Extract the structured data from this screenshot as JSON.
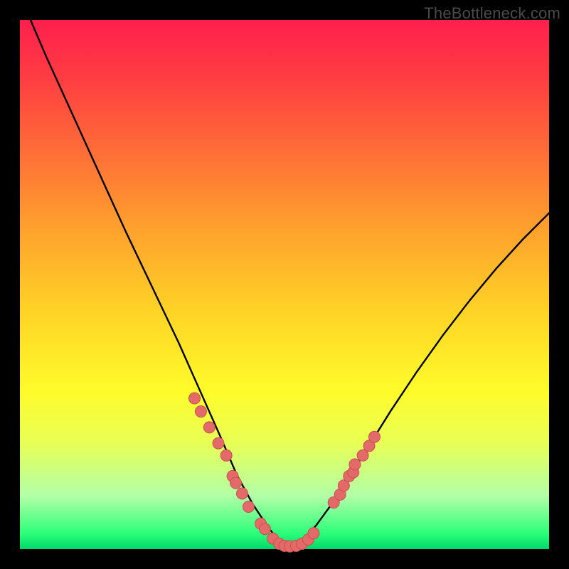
{
  "watermark": "TheBottleneck.com",
  "chart_data": {
    "type": "line",
    "title": "",
    "xlabel": "",
    "ylabel": "",
    "xlim": [
      0,
      100
    ],
    "ylim": [
      0,
      100
    ],
    "legend": false,
    "grid": false,
    "gradient_background": {
      "top_color": "#ff1f4d",
      "bottom_color": "#00d96a",
      "description": "vertical red→orange→yellow→green gradient"
    },
    "series": [
      {
        "name": "bottleneck-curve",
        "stroke": "#000000",
        "x": [
          2,
          5,
          10,
          15,
          20,
          25,
          30,
          34,
          38,
          41,
          44,
          47,
          49,
          51,
          53,
          56,
          60,
          65,
          70,
          75,
          80,
          85,
          90,
          95,
          100
        ],
        "y": [
          100,
          93,
          82,
          71,
          60,
          49.5,
          39,
          30,
          21,
          14,
          8.5,
          4,
          1.5,
          0.5,
          1.2,
          4.5,
          10,
          18,
          26,
          33.5,
          40.5,
          47,
          53,
          58.5,
          63.5
        ]
      }
    ],
    "markers": {
      "name": "highlight-dots",
      "fill": "#e46a6a",
      "stroke": "#c94f4f",
      "radius": 8,
      "points": [
        {
          "x": 33.0,
          "y": 28.5
        },
        {
          "x": 34.2,
          "y": 26.0
        },
        {
          "x": 35.8,
          "y": 23.0
        },
        {
          "x": 37.5,
          "y": 20.0
        },
        {
          "x": 39.0,
          "y": 17.7
        },
        {
          "x": 40.2,
          "y": 13.8
        },
        {
          "x": 40.8,
          "y": 12.5
        },
        {
          "x": 42.0,
          "y": 10.5
        },
        {
          "x": 43.2,
          "y": 8.0
        },
        {
          "x": 45.5,
          "y": 4.8
        },
        {
          "x": 46.3,
          "y": 3.8
        },
        {
          "x": 47.8,
          "y": 2.0
        },
        {
          "x": 49.0,
          "y": 1.0
        },
        {
          "x": 50.0,
          "y": 0.6
        },
        {
          "x": 51.0,
          "y": 0.5
        },
        {
          "x": 52.2,
          "y": 0.6
        },
        {
          "x": 53.3,
          "y": 1.0
        },
        {
          "x": 54.5,
          "y": 1.8
        },
        {
          "x": 55.5,
          "y": 3.0
        },
        {
          "x": 59.3,
          "y": 8.8
        },
        {
          "x": 60.5,
          "y": 10.3
        },
        {
          "x": 61.2,
          "y": 12.0
        },
        {
          "x": 62.2,
          "y": 13.8
        },
        {
          "x": 63.0,
          "y": 14.5
        },
        {
          "x": 63.3,
          "y": 16.0
        },
        {
          "x": 64.8,
          "y": 17.7
        },
        {
          "x": 66.0,
          "y": 19.5
        },
        {
          "x": 67.0,
          "y": 21.2
        }
      ]
    }
  }
}
